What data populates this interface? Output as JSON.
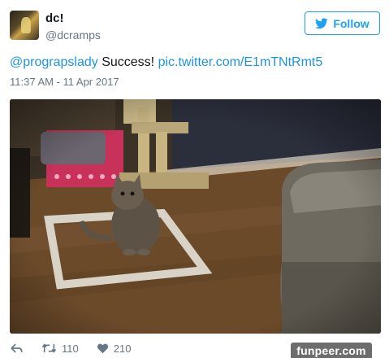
{
  "user": {
    "display_name": "dc!",
    "handle": "@dcramps"
  },
  "follow_button": {
    "label": "Follow",
    "icon": "twitter-bird-icon"
  },
  "tweet": {
    "mention": "@prograpslady",
    "text": " Success! ",
    "link": "pic.twitter.com/E1mTNtRmt5",
    "timestamp": "11:37 AM - 11 Apr 2017"
  },
  "media": {
    "subject": "cat-in-tape-square-photo"
  },
  "actions": {
    "reply_icon": "reply-icon",
    "retweet_icon": "retweet-icon",
    "retweet_count": "110",
    "like_icon": "heart-icon",
    "like_count": "210"
  },
  "watermark": {
    "text": "funpeer.com"
  },
  "colors": {
    "accent": "#1da1f2",
    "link": "#1b95e0",
    "secondary_text": "#657786",
    "primary_text": "#14171a"
  }
}
